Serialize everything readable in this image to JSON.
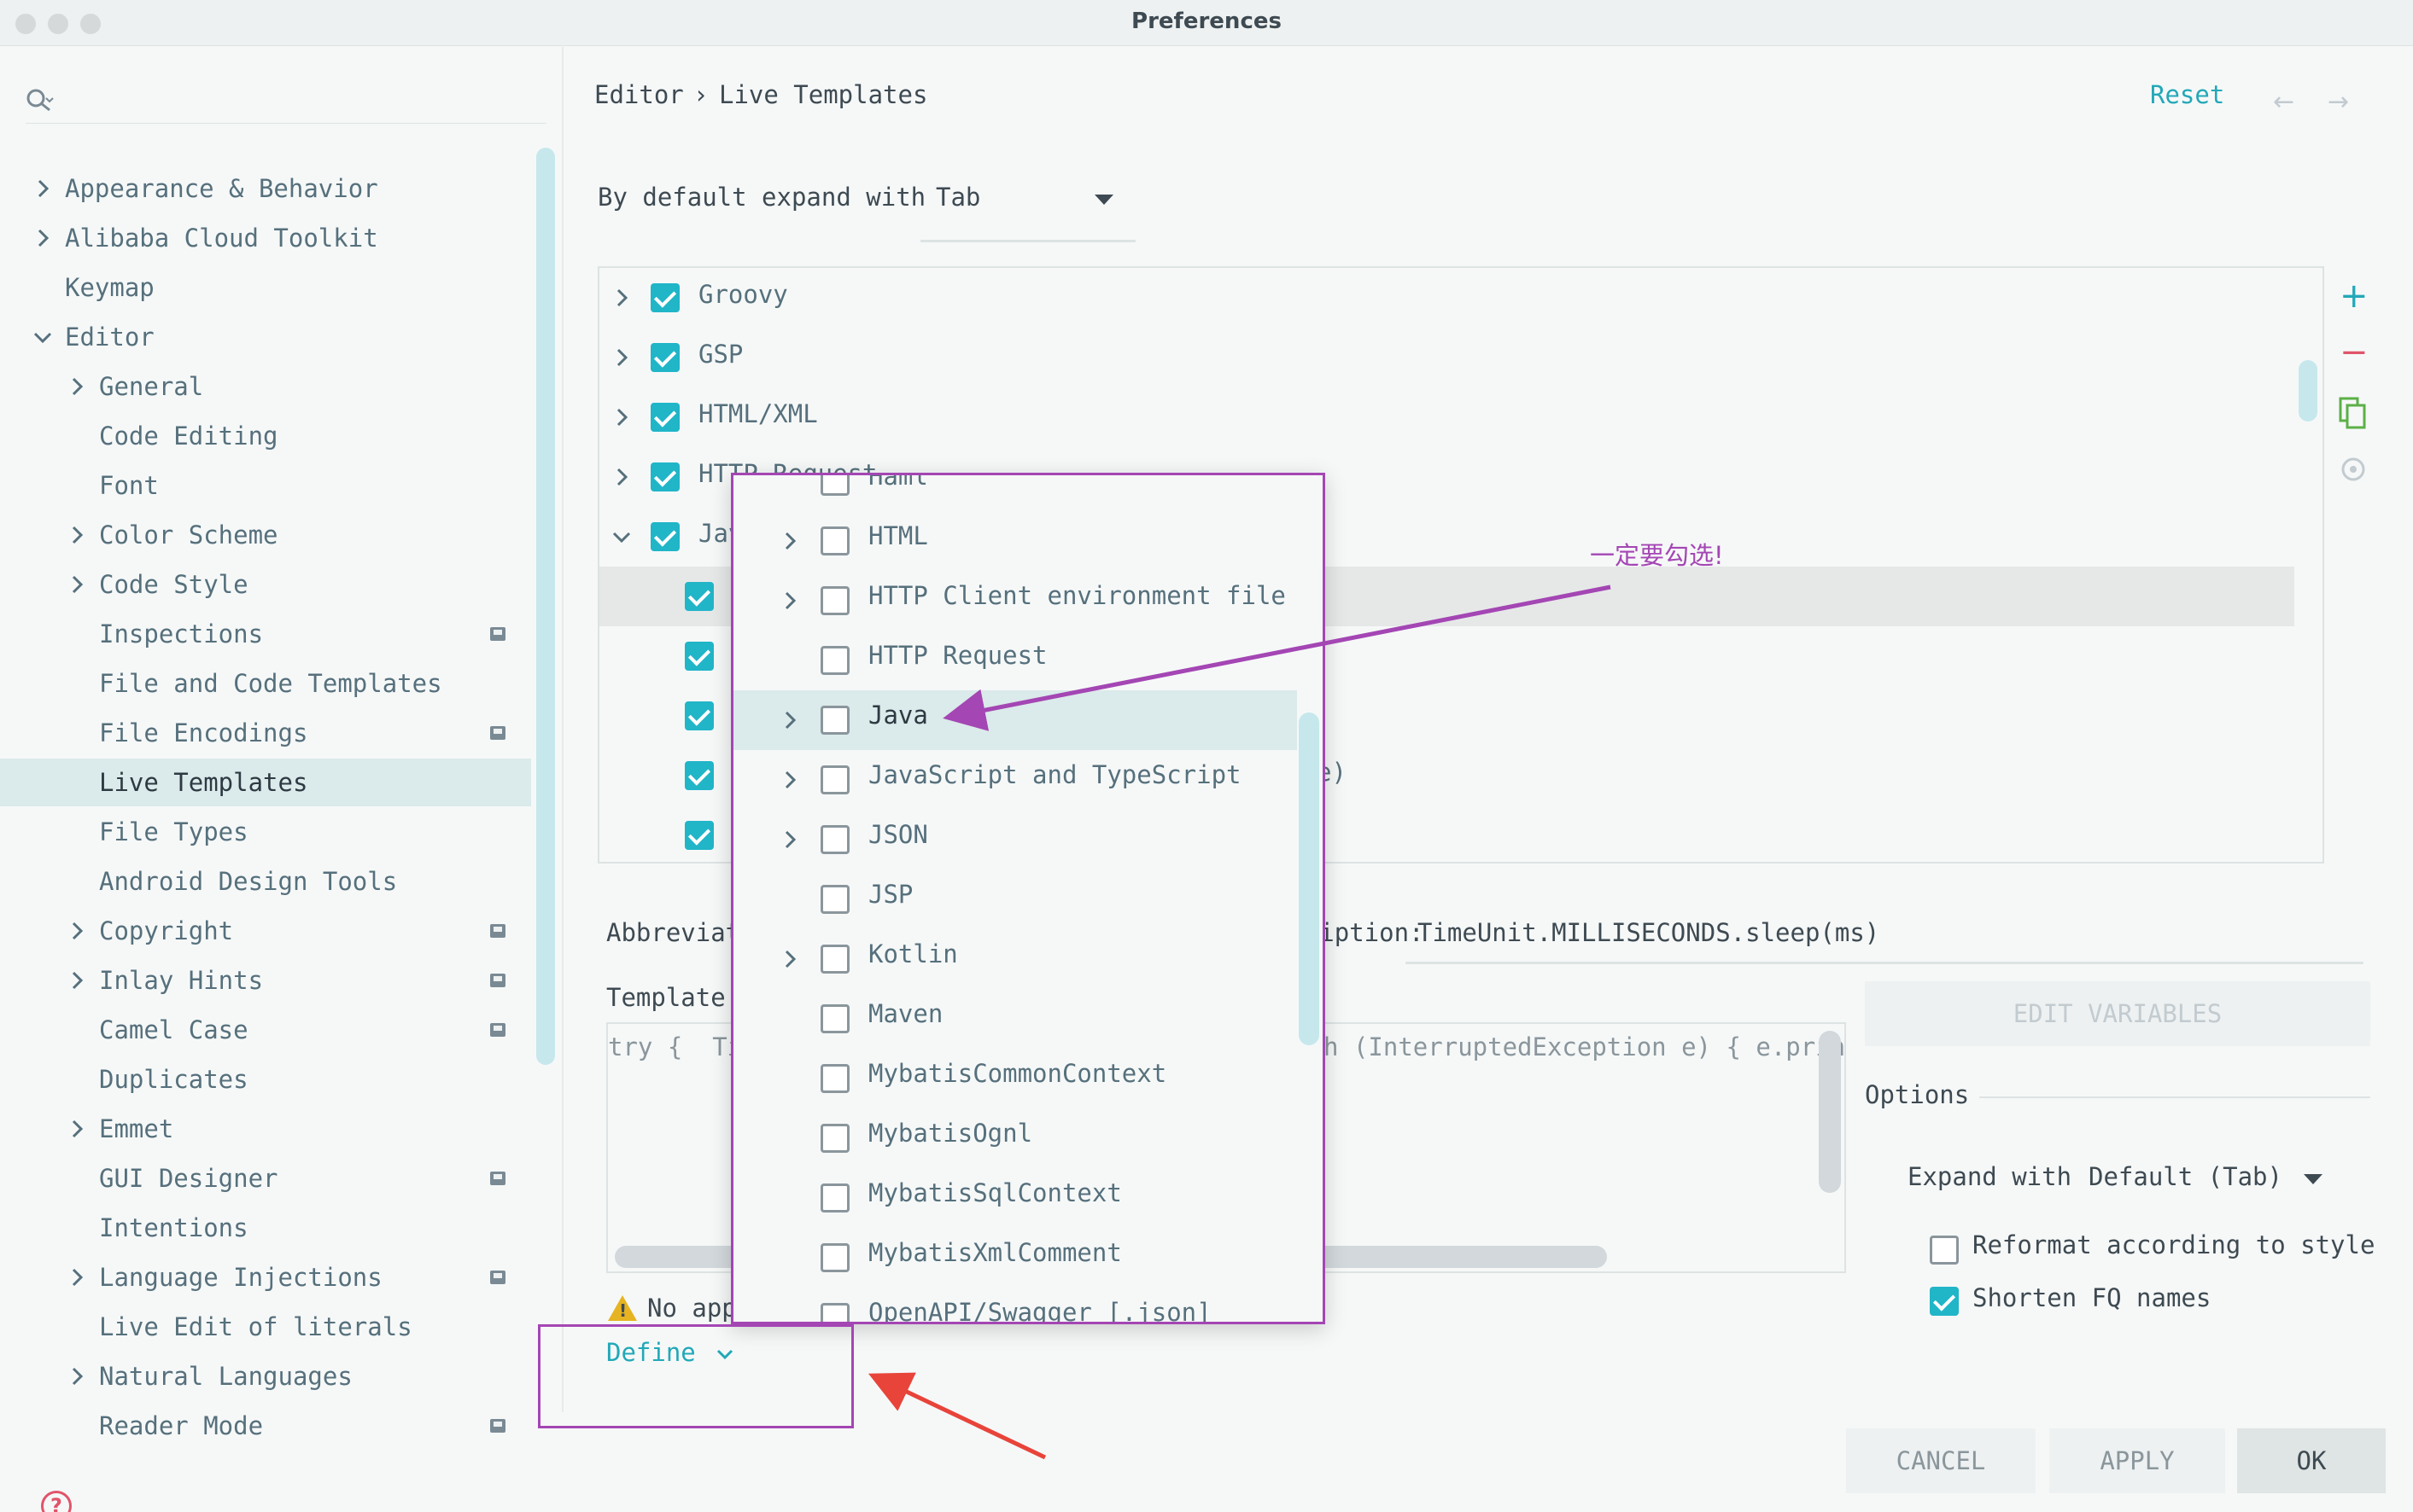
{
  "window": {
    "title": "Preferences"
  },
  "sidebar": {
    "items": [
      {
        "label": "Appearance & Behavior",
        "level": 0,
        "expandable": true,
        "expanded": false,
        "badge": false,
        "selected": false
      },
      {
        "label": "Alibaba Cloud Toolkit",
        "level": 0,
        "expandable": true,
        "expanded": false,
        "badge": false,
        "selected": false
      },
      {
        "label": "Keymap",
        "level": 0,
        "expandable": false,
        "badge": false,
        "selected": false
      },
      {
        "label": "Editor",
        "level": 0,
        "expandable": true,
        "expanded": true,
        "badge": false,
        "selected": false
      },
      {
        "label": "General",
        "level": 1,
        "expandable": true,
        "expanded": false,
        "badge": false,
        "selected": false
      },
      {
        "label": "Code Editing",
        "level": 1,
        "expandable": false,
        "badge": false,
        "selected": false
      },
      {
        "label": "Font",
        "level": 1,
        "expandable": false,
        "badge": false,
        "selected": false
      },
      {
        "label": "Color Scheme",
        "level": 1,
        "expandable": true,
        "expanded": false,
        "badge": false,
        "selected": false
      },
      {
        "label": "Code Style",
        "level": 1,
        "expandable": true,
        "expanded": false,
        "badge": false,
        "selected": false
      },
      {
        "label": "Inspections",
        "level": 1,
        "expandable": false,
        "badge": true,
        "selected": false
      },
      {
        "label": "File and Code Templates",
        "level": 1,
        "expandable": false,
        "badge": false,
        "selected": false
      },
      {
        "label": "File Encodings",
        "level": 1,
        "expandable": false,
        "badge": true,
        "selected": false
      },
      {
        "label": "Live Templates",
        "level": 1,
        "expandable": false,
        "badge": false,
        "selected": true
      },
      {
        "label": "File Types",
        "level": 1,
        "expandable": false,
        "badge": false,
        "selected": false
      },
      {
        "label": "Android Design Tools",
        "level": 1,
        "expandable": false,
        "badge": false,
        "selected": false
      },
      {
        "label": "Copyright",
        "level": 1,
        "expandable": true,
        "expanded": false,
        "badge": true,
        "selected": false
      },
      {
        "label": "Inlay Hints",
        "level": 1,
        "expandable": true,
        "expanded": false,
        "badge": true,
        "selected": false
      },
      {
        "label": "Camel Case",
        "level": 1,
        "expandable": false,
        "badge": true,
        "selected": false
      },
      {
        "label": "Duplicates",
        "level": 1,
        "expandable": false,
        "badge": false,
        "selected": false
      },
      {
        "label": "Emmet",
        "level": 1,
        "expandable": true,
        "expanded": false,
        "badge": false,
        "selected": false
      },
      {
        "label": "GUI Designer",
        "level": 1,
        "expandable": false,
        "badge": true,
        "selected": false
      },
      {
        "label": "Intentions",
        "level": 1,
        "expandable": false,
        "badge": false,
        "selected": false
      },
      {
        "label": "Language Injections",
        "level": 1,
        "expandable": true,
        "expanded": false,
        "badge": true,
        "selected": false
      },
      {
        "label": "Live Edit of literals",
        "level": 1,
        "expandable": false,
        "badge": false,
        "selected": false
      },
      {
        "label": "Natural Languages",
        "level": 1,
        "expandable": true,
        "expanded": false,
        "badge": false,
        "selected": false
      },
      {
        "label": "Reader Mode",
        "level": 1,
        "expandable": false,
        "badge": true,
        "selected": false
      }
    ]
  },
  "breadcrumb": {
    "part1": "Editor",
    "separator": "›",
    "part2": "Live Templates"
  },
  "header": {
    "reset_label": "Reset",
    "back_icon": "←",
    "forward_icon": "→"
  },
  "expand_default": {
    "label": "By default expand with",
    "value": "Tab"
  },
  "template_tree": {
    "rows": [
      {
        "label": "Groovy",
        "expandable": true,
        "expanded": false,
        "checked": true,
        "indent": 0,
        "highlight": false
      },
      {
        "label": "GSP",
        "expandable": true,
        "expanded": false,
        "checked": true,
        "indent": 0,
        "highlight": false
      },
      {
        "label": "HTML/XML",
        "expandable": true,
        "expanded": false,
        "checked": true,
        "indent": 0,
        "highlight": false
      },
      {
        "label": "HTTP Request",
        "expandable": true,
        "expanded": false,
        "checked": true,
        "indent": 0,
        "highlight": false
      },
      {
        "label": "Java",
        "expandable": true,
        "expanded": true,
        "checked": true,
        "indent": 0,
        "highlight": false
      },
      {
        "label": "",
        "expandable": false,
        "checked": true,
        "indent": 1,
        "highlight": true
      },
      {
        "label": "",
        "expandable": false,
        "checked": true,
        "indent": 1,
        "highlight": false
      },
      {
        "label": "",
        "expandable": false,
        "checked": true,
        "indent": 1,
        "highlight": false
      },
      {
        "label": "e)",
        "expandable": false,
        "checked": true,
        "indent": 1,
        "highlight": false
      },
      {
        "label": "",
        "expandable": false,
        "checked": true,
        "indent": 1,
        "highlight": false
      }
    ]
  },
  "toolbar": {
    "add_icon": "+",
    "remove_icon": "−",
    "copy_icon": "copy",
    "restore_icon": "restore"
  },
  "form": {
    "abbreviation_label": "Abbreviation:",
    "description_label": "Description:",
    "description_value": "TimeUnit.MILLISECONDS.sleep(ms)",
    "template_text_label": "Template text:",
    "template_text": "try {  TimeUnit.MILLISECONDS.sleep($ms$); } catch (InterruptedException e) { e.printStackTrace(); }",
    "edit_variables_label": "EDIT VARIABLES",
    "options_label": "Options",
    "expand_with_label": "Expand with",
    "expand_with_value": "Default (Tab)",
    "reformat_label": "Reformat according to style",
    "reformat_checked": false,
    "shorten_label": "Shorten FQ names",
    "shorten_checked": true,
    "warning_text": "No applicable contexts.",
    "define_label": "Define"
  },
  "context_popup": {
    "items": [
      {
        "label": "Haml",
        "expandable": false,
        "checked": false,
        "highlight": false
      },
      {
        "label": "HTML",
        "expandable": true,
        "checked": false,
        "highlight": false
      },
      {
        "label": "HTTP Client environment file",
        "expandable": true,
        "checked": false,
        "highlight": false
      },
      {
        "label": "HTTP Request",
        "expandable": false,
        "checked": false,
        "highlight": false
      },
      {
        "label": "Java",
        "expandable": true,
        "checked": false,
        "highlight": true
      },
      {
        "label": "JavaScript and TypeScript",
        "expandable": true,
        "checked": false,
        "highlight": false
      },
      {
        "label": "JSON",
        "expandable": true,
        "checked": false,
        "highlight": false
      },
      {
        "label": "JSP",
        "expandable": false,
        "checked": false,
        "highlight": false
      },
      {
        "label": "Kotlin",
        "expandable": true,
        "checked": false,
        "highlight": false
      },
      {
        "label": "Maven",
        "expandable": false,
        "checked": false,
        "highlight": false
      },
      {
        "label": "MybatisCommonContext",
        "expandable": false,
        "checked": false,
        "highlight": false
      },
      {
        "label": "MybatisOgnl",
        "expandable": false,
        "checked": false,
        "highlight": false
      },
      {
        "label": "MybatisSqlContext",
        "expandable": false,
        "checked": false,
        "highlight": false
      },
      {
        "label": "MybatisXmlComment",
        "expandable": false,
        "checked": false,
        "highlight": false
      },
      {
        "label": "OpenAPI/Swagger [.json]",
        "expandable": false,
        "checked": false,
        "highlight": false
      }
    ]
  },
  "buttons": {
    "cancel": "CANCEL",
    "apply": "APPLY",
    "ok": "OK"
  },
  "annotation": {
    "note": "一定要勾选!"
  },
  "colors": {
    "accent": "#21b5c8",
    "link": "#22a8b8",
    "annotation_purple": "#a446b4",
    "annotation_red": "#e8443a"
  }
}
